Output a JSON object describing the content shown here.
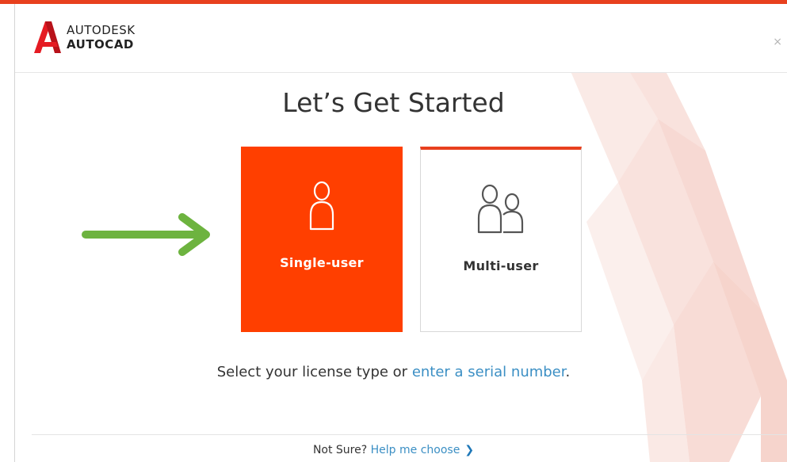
{
  "header": {
    "brand_line1": "AUTODESK",
    "brand_line2": "AUTOCAD",
    "close_label": "×"
  },
  "main": {
    "title": "Let’s Get Started",
    "cards": [
      {
        "label": "Single-user",
        "icon": "single-user-icon",
        "selected": true
      },
      {
        "label": "Multi-user",
        "icon": "multi-user-icon",
        "selected": false
      }
    ],
    "prompt_text": "Select your license type or ",
    "prompt_link": "enter a serial number",
    "prompt_end": "."
  },
  "footer": {
    "text": "Not Sure?",
    "link": "Help me choose",
    "chevron": "❯"
  },
  "colors": {
    "accent": "#ff3f00",
    "brand_red": "#e8401e",
    "link": "#3b8fc4",
    "arrow_green": "#6db33f"
  }
}
